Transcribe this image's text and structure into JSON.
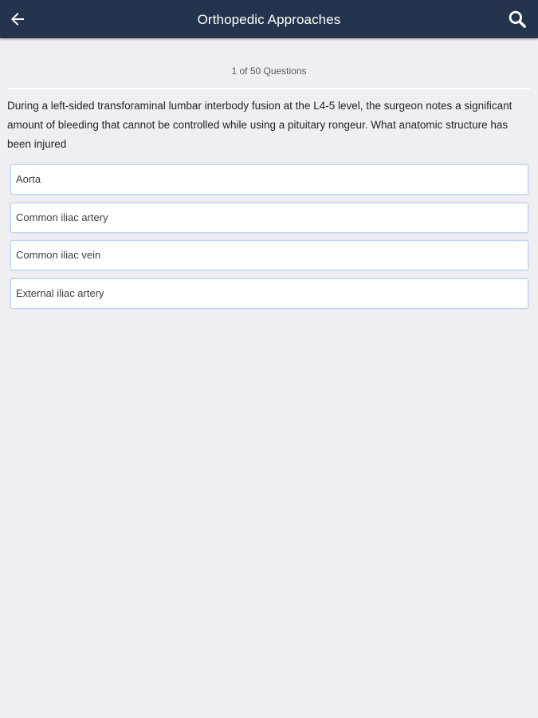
{
  "header": {
    "title": "Orthopedic Approaches",
    "back_icon": "arrow-left-icon",
    "search_icon": "search-icon"
  },
  "quiz": {
    "progress": "1 of 50 Questions",
    "question": "During a left-sided transforaminal lumbar interbody fusion at the L4-5 level, the surgeon notes a significant amount of bleeding that cannot be controlled while using a pituitary rongeur. What anatomic structure has been injured",
    "options": [
      "Aorta",
      "Common iliac artery",
      "Common iliac vein",
      "External iliac artery"
    ]
  },
  "colors": {
    "app_bar": "#24344d",
    "background": "#efeff3",
    "option_border": "#b5d4f4"
  }
}
